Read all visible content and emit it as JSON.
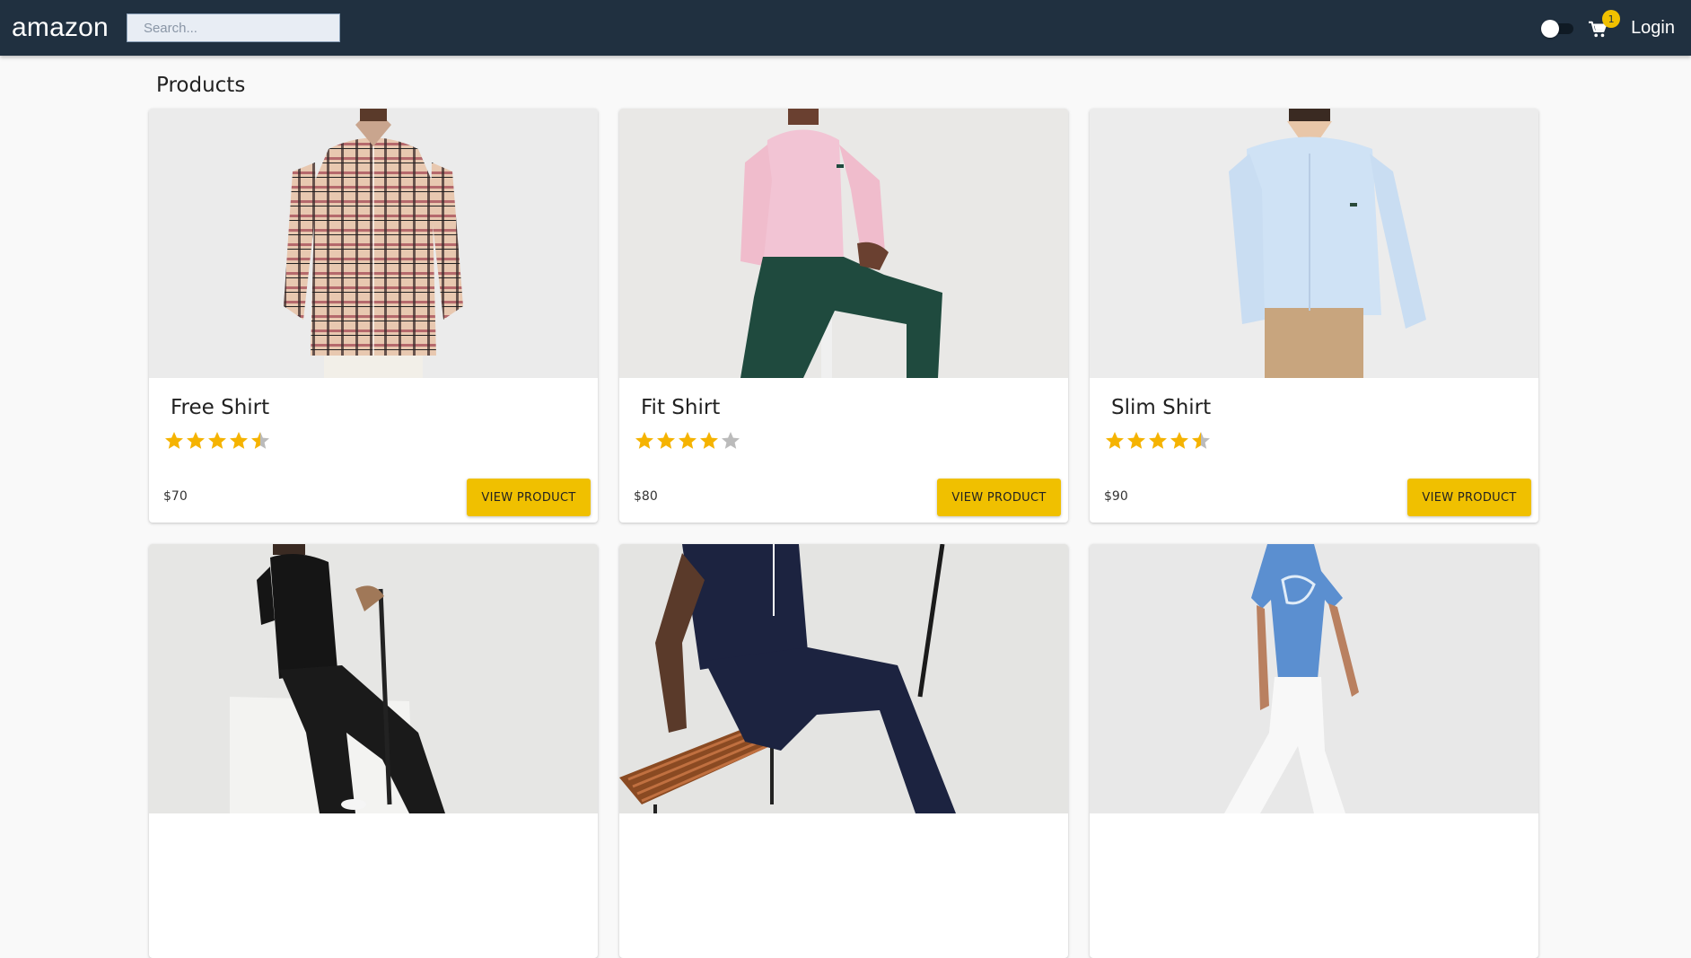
{
  "app": {
    "brand": "amazon"
  },
  "header": {
    "search_placeholder": "Search...",
    "cart_count": "1",
    "login_label": "Login"
  },
  "page": {
    "title": "Products"
  },
  "colors": {
    "navbar": "#203040",
    "accent": "#f0c000",
    "star": "#f5b301",
    "star_empty": "#bbbbbb"
  },
  "products": [
    {
      "name": "Free Shirt",
      "rating": 4.5,
      "price": "$70",
      "button": "VIEW PRODUCT"
    },
    {
      "name": "Fit Shirt",
      "rating": 4,
      "price": "$80",
      "button": "VIEW PRODUCT"
    },
    {
      "name": "Slim Shirt",
      "rating": 4.5,
      "price": "$90",
      "button": "VIEW PRODUCT"
    },
    {
      "name": "",
      "rating": 0,
      "price": "",
      "button": ""
    },
    {
      "name": "",
      "rating": 0,
      "price": "",
      "button": ""
    },
    {
      "name": "",
      "rating": 0,
      "price": "",
      "button": ""
    }
  ]
}
